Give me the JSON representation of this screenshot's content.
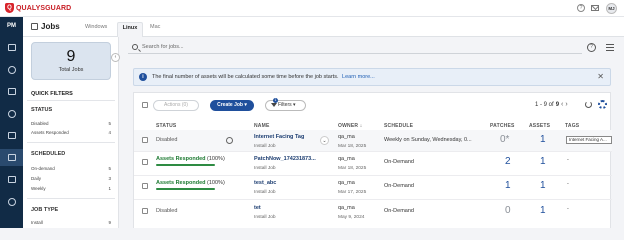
{
  "brand": {
    "logo_letter": "Q",
    "name": "QUALYSGUARD"
  },
  "topbar": {
    "help": "?",
    "avatar_initials": "MJ"
  },
  "nav": {
    "module": "PM"
  },
  "header": {
    "title": "Jobs",
    "tabs": [
      {
        "label": "Windows"
      },
      {
        "label": "Linux"
      },
      {
        "label": "Mac"
      }
    ]
  },
  "summary": {
    "total_value": "9",
    "total_label": "Total Jobs"
  },
  "quick_filters": {
    "title": "QUICK FILTERS",
    "status": {
      "title": "STATUS",
      "items": [
        {
          "label": "Disabled",
          "count": "5"
        },
        {
          "label": "Assets Responded",
          "count": "4"
        }
      ]
    },
    "scheduled": {
      "title": "SCHEDULED",
      "items": [
        {
          "label": "On-demand",
          "count": "5"
        },
        {
          "label": "Daily",
          "count": "3"
        },
        {
          "label": "Weekly",
          "count": "1"
        }
      ]
    },
    "job_type": {
      "title": "JOB TYPE",
      "items": [
        {
          "label": "Install",
          "count": "9"
        }
      ]
    }
  },
  "search": {
    "placeholder": "Search for jobs..."
  },
  "banner": {
    "text": "The final number of assets will be calculated some time before the job starts.",
    "link": "Learn more..."
  },
  "toolbar": {
    "actions_label": "Actions (0)",
    "create_label": "Create Job",
    "filters_label": "Filters",
    "filters_badge": "1",
    "pagination": {
      "range": "1 - 9 of",
      "total": "9"
    }
  },
  "columns": {
    "status": "STATUS",
    "name": "NAME",
    "owner": "OWNER",
    "schedule": "SCHEDULE",
    "patches": "PATCHES",
    "assets": "ASSETS",
    "tags": "TAGS"
  },
  "rows": [
    {
      "status": "Disabled",
      "name": "Internet Facing Tag",
      "type": "Install Job",
      "owner": "qa_ma",
      "date": "Mar 18, 2025",
      "schedule": "Weekly on Sunday, Wednesday, 0...",
      "patches": "0*",
      "assets": "1",
      "tag": "Internet Facing A..."
    },
    {
      "status": "Assets Responded",
      "pct": "(100%)",
      "name": "PatchNow_174231873...",
      "type": "Install Job",
      "owner": "qa_ma",
      "date": "Mar 18, 2025",
      "schedule": "On-Demand",
      "patches": "2",
      "assets": "1",
      "tag": "-"
    },
    {
      "status": "Assets Responded",
      "pct": "(100%)",
      "name": "test_abc",
      "type": "Install Job",
      "owner": "qa_ma",
      "date": "Mar 17, 2025",
      "schedule": "On-Demand",
      "patches": "1",
      "assets": "1",
      "tag": "-"
    },
    {
      "status": "Disabled",
      "name": "tet",
      "type": "Install Job",
      "owner": "qa_ma",
      "date": "May 9, 2024",
      "schedule": "On-Demand",
      "patches": "0",
      "assets": "1",
      "tag": "-"
    }
  ],
  "colors": {
    "brand_red": "#c81e25",
    "nav_bg": "#112b46",
    "accent_blue": "#1f4f9c",
    "success_green": "#2e8b43"
  }
}
